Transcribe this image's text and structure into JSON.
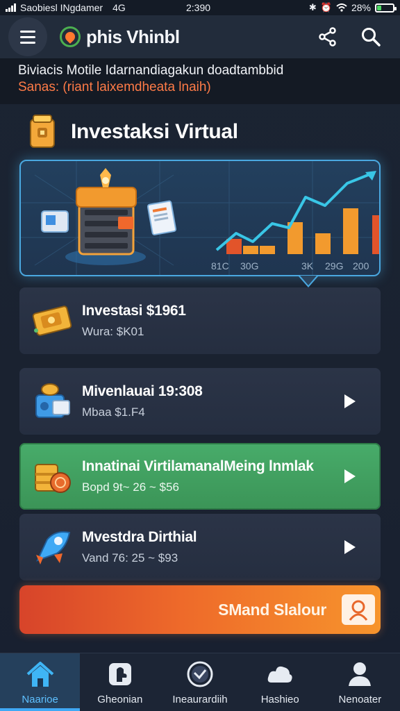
{
  "status_bar": {
    "carrier": "Saobiesl INgdamer",
    "network": "4G",
    "time": "2:390",
    "battery": "28%",
    "battery_level": 0.28
  },
  "header": {
    "app_name": "phis Vhinbl"
  },
  "banner": {
    "line1": "Biviacis Motile Idarnandiagakun doadtambbid",
    "line2": "Sanas: (riant laixemdheata lnaih)"
  },
  "section": {
    "title": "Investaksi Virtual"
  },
  "hero": {
    "tick_labels": [
      "81C",
      "30G",
      "3K",
      "29G",
      "200"
    ]
  },
  "cards": [
    {
      "title": "Investasi $1961",
      "subtitle": "Wura: $K01",
      "has_chevron": false
    },
    {
      "title": "Mivenlauai 19:308",
      "subtitle": "Mbaa $1.F4",
      "has_chevron": true
    },
    {
      "title": "Innatinai VirtilamanalMeing lnmlak",
      "subtitle": "Bopd  9t~ 26 ~ $56",
      "has_chevron": true
    },
    {
      "title": "Mvestdra Dirthial",
      "subtitle": "Vand 76: 25 ~ $93",
      "has_chevron": true
    }
  ],
  "cta": {
    "label": "SMand Slalour"
  },
  "bottom_nav": [
    {
      "label": "Naarioe",
      "icon": "home-icon",
      "active": true
    },
    {
      "label": "Gheonian",
      "icon": "puzzle-icon",
      "active": false
    },
    {
      "label": "Ineaurardiih",
      "icon": "clock-icon",
      "active": false
    },
    {
      "label": "Hashieo",
      "icon": "cloud-icon",
      "active": false
    },
    {
      "label": "Nenoater",
      "icon": "user-icon",
      "active": false
    }
  ],
  "colors": {
    "accent_blue": "#3fa9f5",
    "accent_orange": "#ff7b47",
    "green_card": "#48ac6a",
    "cta_start": "#d7442a",
    "cta_end": "#f7942c"
  }
}
